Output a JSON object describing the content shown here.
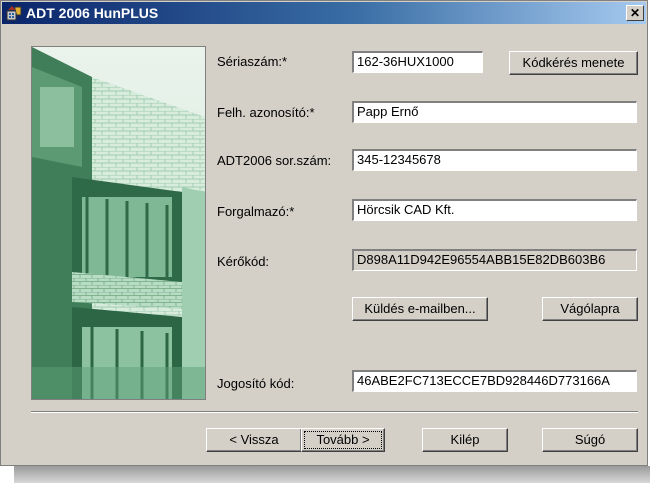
{
  "window": {
    "title": "ADT 2006 HunPLUS",
    "close_glyph": "✕"
  },
  "fields": {
    "serial": {
      "label": "Sériaszám:*",
      "value": "162-36HUX1000"
    },
    "user_id": {
      "label": "Felh. azonosító:*",
      "value": "Papp Ernő"
    },
    "adt_serial": {
      "label": "ADT2006 sor.szám:",
      "value": "345-12345678"
    },
    "distributor": {
      "label": "Forgalmazó:*",
      "value": "Hörcsik CAD Kft."
    },
    "request_code": {
      "label": "Kérőkód:",
      "value": "D898A11D942E96554ABB15E82DB603B6"
    },
    "auth_code": {
      "label": "Jogosító kód:",
      "value": "46ABE2FC713ECCE7BD928446D773166A"
    }
  },
  "buttons": {
    "code_request": "Kódkérés menete",
    "send_email": "Küldés e-mailben...",
    "clipboard": "Vágólapra",
    "back": "< Vissza",
    "next": "Tovább >",
    "exit": "Kilép",
    "help": "Súgó"
  },
  "colors": {
    "title_start": "#0a246a",
    "title_end": "#a6caf0",
    "banner_tint": "#6fbf8f",
    "dialog_bg": "#d4d0c8"
  },
  "icons": {
    "app": "app-icon",
    "close": "close-icon"
  }
}
